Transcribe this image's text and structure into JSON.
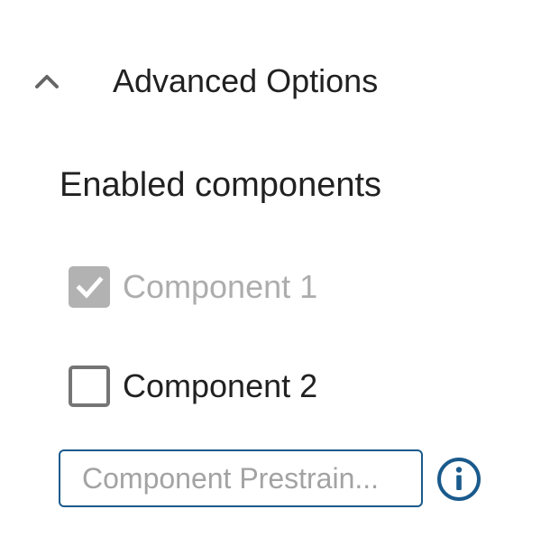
{
  "section": {
    "title": "Advanced Options",
    "expanded": true,
    "chevron_icon": "chevron-up-icon"
  },
  "components_group": {
    "title": "Enabled components",
    "items": [
      {
        "label": "Component 1",
        "checked": true,
        "disabled": true
      },
      {
        "label": "Component 2",
        "checked": false,
        "disabled": false
      }
    ]
  },
  "prestrain_input": {
    "value": "",
    "placeholder": "Component Prestrain..."
  },
  "info_button": {
    "icon": "info-icon"
  },
  "colors": {
    "accent": "#1a5a8c",
    "text": "#212121",
    "disabled_text": "#adadad",
    "disabled_checkbox": "#b2b2b2",
    "checkbox_border": "#757575",
    "chevron": "#666666"
  }
}
